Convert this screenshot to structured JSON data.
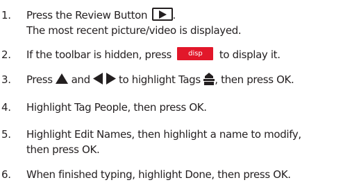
{
  "steps": [
    {
      "number": "1.",
      "lines": [
        [
          "Press the Review Button ",
          "."
        ],
        [
          "The most recent picture/video is displayed."
        ]
      ]
    },
    {
      "number": "2.",
      "lines": [
        [
          "If the toolbar is hidden, press ",
          " to display it."
        ]
      ],
      "button_label": "disp"
    },
    {
      "number": "3.",
      "lines": [
        [
          "Press ",
          " and ",
          " ",
          " to highlight Tags ",
          ", then press OK."
        ]
      ]
    },
    {
      "number": "4.",
      "lines": [
        [
          "Highlight Tag People, then press OK."
        ]
      ]
    },
    {
      "number": "5.",
      "lines": [
        [
          "Highlight Edit Names, then highlight a name to modify,"
        ],
        [
          "then press OK."
        ]
      ]
    },
    {
      "number": "6.",
      "lines": [
        [
          "When finished typing, highlight Done, then press OK."
        ]
      ]
    }
  ],
  "icons": {
    "review": "play-triangle-icon",
    "up": "up-arrow-icon",
    "left": "left-arrow-icon",
    "right": "right-arrow-icon",
    "tags": "tag-icon"
  },
  "colors": {
    "disp_button": "#e2172a",
    "text": "#231f20"
  }
}
